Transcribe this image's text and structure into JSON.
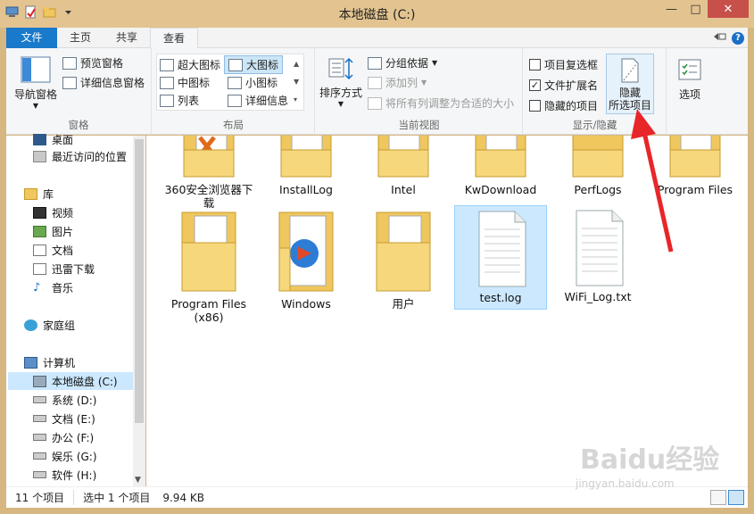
{
  "window": {
    "title": "本地磁盘 (C:)",
    "minimize": "—",
    "maximize": "□",
    "close": "✕"
  },
  "tabs": {
    "file": "文件",
    "home": "主页",
    "share": "共享",
    "view": "查看"
  },
  "ribbon": {
    "panes": {
      "label": "窗格",
      "nav_pane": "导航窗格",
      "preview_pane": "预览窗格",
      "details_pane": "详细信息窗格"
    },
    "layout": {
      "label": "布局",
      "extra_large": "超大图标",
      "large": "大图标",
      "medium": "中图标",
      "small": "小图标",
      "list": "列表",
      "details": "详细信息"
    },
    "current_view": {
      "label": "当前视图",
      "sort_by": "排序方式",
      "group_by": "分组依据",
      "add_columns": "添加列",
      "size_columns": "将所有列调整为合适的大小"
    },
    "show_hide": {
      "label": "显示/隐藏",
      "item_checkboxes": "项目复选框",
      "file_extensions": "文件扩展名",
      "hidden_items": "隐藏的项目",
      "hide_selected_line1": "隐藏",
      "hide_selected_line2": "所选项目",
      "options": "选项"
    }
  },
  "nav": {
    "desktop": "桌面",
    "recent": "最近访问的位置",
    "libraries": "库",
    "videos": "视频",
    "pictures": "图片",
    "documents": "文档",
    "xunlei": "迅雷下载",
    "music": "音乐",
    "homegroup": "家庭组",
    "computer": "计算机",
    "drive_c": "本地磁盘 (C:)",
    "drive_d": "系统 (D:)",
    "drive_e": "文档 (E:)",
    "drive_f": "办公 (F:)",
    "drive_g": "娱乐 (G:)",
    "drive_h": "软件 (H:)"
  },
  "items": [
    {
      "name": "360安全浏览器下载",
      "type": "folder"
    },
    {
      "name": "InstallLog",
      "type": "folder"
    },
    {
      "name": "Intel",
      "type": "folder"
    },
    {
      "name": "KwDownload",
      "type": "folder"
    },
    {
      "name": "PerfLogs",
      "type": "folder"
    },
    {
      "name": "Program Files",
      "type": "folder"
    },
    {
      "name": "Program Files (x86)",
      "type": "folder"
    },
    {
      "name": "Windows",
      "type": "folder"
    },
    {
      "name": "用户",
      "type": "folder"
    },
    {
      "name": "test.log",
      "type": "file"
    },
    {
      "name": "WiFi_Log.txt",
      "type": "file"
    }
  ],
  "status": {
    "count": "11 个项目",
    "selected": "选中 1 个项目",
    "size": "9.94 KB"
  },
  "watermark": {
    "brand": "Baidu经验",
    "url": "jingyan.baidu.com"
  },
  "colors": {
    "accent": "#1979ca",
    "selection": "#cce8ff",
    "folder": "#f0c75e",
    "arrow": "#e8262a"
  }
}
